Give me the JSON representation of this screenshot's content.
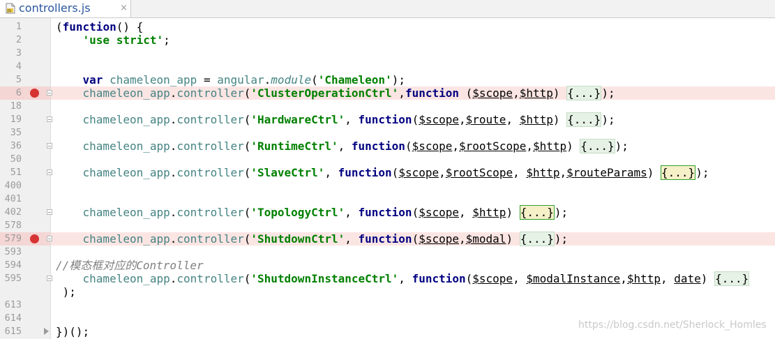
{
  "tab": {
    "icon": "js-file-icon",
    "label": "controllers.js",
    "close": "×"
  },
  "lines": [
    {
      "num": "1",
      "segs": [
        {
          "t": "(",
          "c": ""
        },
        {
          "t": "function",
          "c": "kw"
        },
        {
          "t": "() {",
          "c": ""
        }
      ]
    },
    {
      "num": "2",
      "segs": [
        {
          "t": "    ",
          "c": ""
        },
        {
          "t": "'use strict'",
          "c": "str"
        },
        {
          "t": ";",
          "c": ""
        }
      ]
    },
    {
      "num": "3",
      "segs": []
    },
    {
      "num": "4",
      "segs": []
    },
    {
      "num": "5",
      "segs": [
        {
          "t": "    ",
          "c": ""
        },
        {
          "t": "var",
          "c": "kw"
        },
        {
          "t": " ",
          "c": ""
        },
        {
          "t": "chameleon_app",
          "c": "ident"
        },
        {
          "t": " = ",
          "c": ""
        },
        {
          "t": "angular",
          "c": "ident"
        },
        {
          "t": ".",
          "c": ""
        },
        {
          "t": "module",
          "c": "fn"
        },
        {
          "t": "(",
          "c": ""
        },
        {
          "t": "'Chameleon'",
          "c": "str"
        },
        {
          "t": ");",
          "c": ""
        }
      ]
    },
    {
      "num": "6",
      "bp": true,
      "fold": true,
      "segs": [
        {
          "t": "    ",
          "c": ""
        },
        {
          "t": "chameleon_app",
          "c": "ident"
        },
        {
          "t": ".",
          "c": ""
        },
        {
          "t": "controller",
          "c": "ident"
        },
        {
          "t": "(",
          "c": ""
        },
        {
          "t": "'ClusterOperationCtrl'",
          "c": "str"
        },
        {
          "t": ",",
          "c": ""
        },
        {
          "t": "function",
          "c": "kw"
        },
        {
          "t": " (",
          "c": ""
        },
        {
          "t": "$scope",
          "c": "prm"
        },
        {
          "t": ",",
          "c": ""
        },
        {
          "t": "$http",
          "c": "prm"
        },
        {
          "t": ") ",
          "c": ""
        },
        {
          "t": "{...}",
          "c": "fold-box"
        },
        {
          "t": ");",
          "c": ""
        }
      ]
    },
    {
      "num": "18",
      "segs": []
    },
    {
      "num": "19",
      "fold": true,
      "segs": [
        {
          "t": "    ",
          "c": ""
        },
        {
          "t": "chameleon_app",
          "c": "ident"
        },
        {
          "t": ".",
          "c": ""
        },
        {
          "t": "controller",
          "c": "ident"
        },
        {
          "t": "(",
          "c": ""
        },
        {
          "t": "'HardwareCtrl'",
          "c": "str"
        },
        {
          "t": ", ",
          "c": ""
        },
        {
          "t": "function",
          "c": "kw"
        },
        {
          "t": "(",
          "c": ""
        },
        {
          "t": "$scope",
          "c": "prm"
        },
        {
          "t": ",",
          "c": ""
        },
        {
          "t": "$route",
          "c": "prm"
        },
        {
          "t": ", ",
          "c": ""
        },
        {
          "t": "$http",
          "c": "prm"
        },
        {
          "t": ") ",
          "c": ""
        },
        {
          "t": "{...}",
          "c": "fold-box"
        },
        {
          "t": ");",
          "c": ""
        }
      ]
    },
    {
      "num": "35",
      "segs": []
    },
    {
      "num": "36",
      "fold": true,
      "segs": [
        {
          "t": "    ",
          "c": ""
        },
        {
          "t": "chameleon_app",
          "c": "ident"
        },
        {
          "t": ".",
          "c": ""
        },
        {
          "t": "controller",
          "c": "ident"
        },
        {
          "t": "(",
          "c": ""
        },
        {
          "t": "'RuntimeCtrl'",
          "c": "str"
        },
        {
          "t": ", ",
          "c": ""
        },
        {
          "t": "function",
          "c": "kw"
        },
        {
          "t": "(",
          "c": ""
        },
        {
          "t": "$scope",
          "c": "prm"
        },
        {
          "t": ",",
          "c": ""
        },
        {
          "t": "$rootScope",
          "c": "prm"
        },
        {
          "t": ",",
          "c": ""
        },
        {
          "t": "$http",
          "c": "prm"
        },
        {
          "t": ") ",
          "c": ""
        },
        {
          "t": "{...}",
          "c": "fold-box"
        },
        {
          "t": ");",
          "c": ""
        }
      ]
    },
    {
      "num": "50",
      "segs": []
    },
    {
      "num": "51",
      "fold": true,
      "segs": [
        {
          "t": "    ",
          "c": ""
        },
        {
          "t": "chameleon_app",
          "c": "ident"
        },
        {
          "t": ".",
          "c": ""
        },
        {
          "t": "controller",
          "c": "ident"
        },
        {
          "t": "(",
          "c": ""
        },
        {
          "t": "'SlaveCtrl'",
          "c": "str"
        },
        {
          "t": ", ",
          "c": ""
        },
        {
          "t": "function",
          "c": "kw"
        },
        {
          "t": "(",
          "c": ""
        },
        {
          "t": "$scope",
          "c": "prm"
        },
        {
          "t": ",",
          "c": ""
        },
        {
          "t": "$rootScope",
          "c": "prm"
        },
        {
          "t": ", ",
          "c": ""
        },
        {
          "t": "$http",
          "c": "prm"
        },
        {
          "t": ",",
          "c": ""
        },
        {
          "t": "$routeParams",
          "c": "prm"
        },
        {
          "t": ") ",
          "c": ""
        },
        {
          "t": "{...}",
          "c": "fold-box on"
        },
        {
          "t": ");",
          "c": ""
        }
      ]
    },
    {
      "num": "400",
      "segs": []
    },
    {
      "num": "401",
      "segs": []
    },
    {
      "num": "402",
      "fold": true,
      "segs": [
        {
          "t": "    ",
          "c": ""
        },
        {
          "t": "chameleon_app",
          "c": "ident"
        },
        {
          "t": ".",
          "c": ""
        },
        {
          "t": "controller",
          "c": "ident"
        },
        {
          "t": "(",
          "c": ""
        },
        {
          "t": "'TopologyCtrl'",
          "c": "str"
        },
        {
          "t": ", ",
          "c": ""
        },
        {
          "t": "function",
          "c": "kw"
        },
        {
          "t": "(",
          "c": ""
        },
        {
          "t": "$scope",
          "c": "prm"
        },
        {
          "t": ", ",
          "c": ""
        },
        {
          "t": "$http",
          "c": "prm"
        },
        {
          "t": ") ",
          "c": ""
        },
        {
          "t": "{...}",
          "c": "fold-box on"
        },
        {
          "t": ");",
          "c": ""
        }
      ]
    },
    {
      "num": "578",
      "segs": []
    },
    {
      "num": "579",
      "bp": true,
      "fold": true,
      "segs": [
        {
          "t": "    ",
          "c": ""
        },
        {
          "t": "chameleon_app",
          "c": "ident"
        },
        {
          "t": ".",
          "c": ""
        },
        {
          "t": "controller",
          "c": "ident"
        },
        {
          "t": "(",
          "c": ""
        },
        {
          "t": "'ShutdownCtrl'",
          "c": "str"
        },
        {
          "t": ", ",
          "c": ""
        },
        {
          "t": "function",
          "c": "kw"
        },
        {
          "t": "(",
          "c": ""
        },
        {
          "t": "$scope",
          "c": "prm"
        },
        {
          "t": ",",
          "c": ""
        },
        {
          "t": "$modal",
          "c": "prm"
        },
        {
          "t": ") ",
          "c": ""
        },
        {
          "t": "{...}",
          "c": "fold-box"
        },
        {
          "t": ");",
          "c": ""
        }
      ]
    },
    {
      "num": "593",
      "segs": []
    },
    {
      "num": "594",
      "segs": [
        {
          "t": "//模态框对应的Controller",
          "c": "cmt"
        }
      ]
    },
    {
      "num": "595",
      "fold": true,
      "segs": [
        {
          "t": "    ",
          "c": ""
        },
        {
          "t": "chameleon_app",
          "c": "ident"
        },
        {
          "t": ".",
          "c": ""
        },
        {
          "t": "controller",
          "c": "ident"
        },
        {
          "t": "(",
          "c": ""
        },
        {
          "t": "'ShutdownInstanceCtrl'",
          "c": "str"
        },
        {
          "t": ", ",
          "c": ""
        },
        {
          "t": "function",
          "c": "kw"
        },
        {
          "t": "(",
          "c": ""
        },
        {
          "t": "$scope",
          "c": "prm"
        },
        {
          "t": ", ",
          "c": ""
        },
        {
          "t": "$modalInstance",
          "c": "prm"
        },
        {
          "t": ",",
          "c": ""
        },
        {
          "t": "$http",
          "c": "prm"
        },
        {
          "t": ", ",
          "c": ""
        },
        {
          "t": "date",
          "c": "prm"
        },
        {
          "t": ") ",
          "c": ""
        },
        {
          "t": "{...}",
          "c": "fold-box"
        }
      ]
    },
    {
      "num": "",
      "segs": [
        {
          "t": " );",
          "c": ""
        }
      ]
    },
    {
      "num": "613",
      "segs": []
    },
    {
      "num": "614",
      "segs": []
    },
    {
      "num": "615",
      "foldEnd": true,
      "segs": [
        {
          "t": "})();",
          "c": ""
        }
      ]
    }
  ],
  "watermark": "https://blog.csdn.net/Sherlock_Homles"
}
